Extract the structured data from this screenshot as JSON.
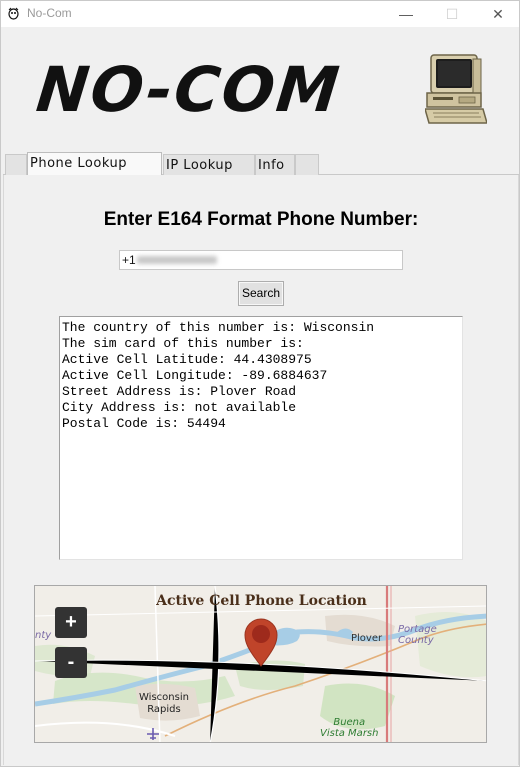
{
  "window": {
    "title": "No-Com",
    "controls": {
      "minimize": "—",
      "maximize": "☐",
      "close": "✕"
    }
  },
  "header": {
    "logo_text": "NO-COM",
    "icon": "retro-computer-icon"
  },
  "tabs": [
    {
      "label": "Phone Lookup",
      "active": true
    },
    {
      "label": "IP Lookup",
      "active": false
    },
    {
      "label": "Info",
      "active": false
    }
  ],
  "form": {
    "heading": "Enter E164 Format Phone Number:",
    "phone_prefix": "+1",
    "search_label": "Search"
  },
  "results": {
    "lines": [
      "The country of this number is: Wisconsin",
      "The sim card of this number is:",
      "Active Cell Latitude: 44.4308975",
      "Active Cell Longitude: -89.6884637",
      "Street Address is: Plover Road",
      "City Address is: not available",
      "Postal Code is: 54494"
    ]
  },
  "map": {
    "title": "Active Cell Phone Location",
    "zoom_in": "+",
    "zoom_out": "-",
    "labels": {
      "plover": "Plover",
      "portage_1": "Portage",
      "portage_2": "County",
      "rapids_1": "Wisconsin",
      "rapids_2": "Rapids",
      "buena_1": "Buena",
      "buena_2": "Vista Marsh",
      "edge": "nty"
    },
    "colors": {
      "marker": "#c0442a",
      "river": "#a7cde6",
      "road": "#d87b7b"
    }
  }
}
